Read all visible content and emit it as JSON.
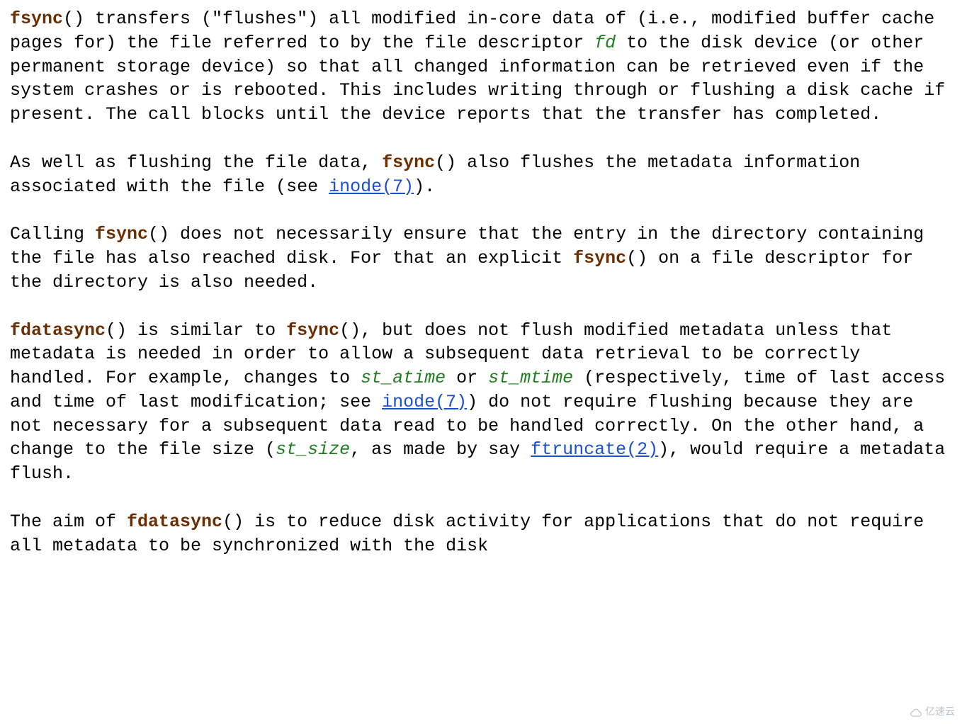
{
  "p1": {
    "s0": "fsync",
    "s1": "() transfers (\"flushes\") all modified in-core data of (i.e., modified buffer cache pages for) the file referred to by the file descriptor ",
    "s2": "fd",
    "s3": " to the disk device (or other permanent storage device) so that all changed information can be retrieved even if the system crashes or is rebooted.  This includes writing through or flushing a disk cache if present.  The call blocks until the device reports that the transfer has completed."
  },
  "p2": {
    "s0": "As well as flushing the file data, ",
    "s1": "fsync",
    "s2": "() also flushes the metadata information associated with the file (see ",
    "s3": "inode(7)",
    "s4": ")."
  },
  "p3": {
    "s0": "Calling ",
    "s1": "fsync",
    "s2": "() does not necessarily ensure that the entry in the directory containing the file has also reached disk.  For that an explicit ",
    "s3": "fsync",
    "s4": "() on a file descriptor for the directory is also needed."
  },
  "p4": {
    "s0": "fdatasync",
    "s1": "() is similar to ",
    "s2": "fsync",
    "s3": "(), but does not flush modified metadata unless that metadata is needed in order to allow a subsequent data retrieval to be correctly handled.  For example, changes to ",
    "s4": "st_atime",
    "s5": " or ",
    "s6": "st_mtime",
    "s7": " (respectively, time of last access and time of last modification; see ",
    "s8": "inode(7)",
    "s9": ") do not require flushing because they are not necessary for a subsequent data read to be handled correctly.  On the other hand, a change to the file size (",
    "s10": "st_size",
    "s11": ", as made by say ",
    "s12": "ftruncate(2)",
    "s13": "), would require a metadata flush."
  },
  "p5": {
    "s0": "The aim of ",
    "s1": "fdatasync",
    "s2": "() is to reduce disk activity for applications that do not require all metadata to be synchronized with the disk"
  },
  "watermark": "亿速云"
}
